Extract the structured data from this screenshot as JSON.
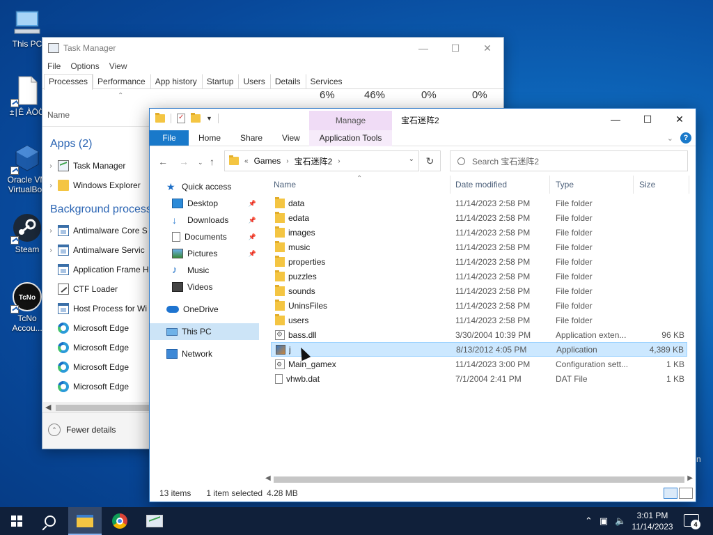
{
  "desktop": {
    "icons": [
      {
        "label": "This PC"
      },
      {
        "label": "±∣Ê ÀÖÖ"
      },
      {
        "label": "Oracle VM VirtualBox"
      },
      {
        "label": "Steam"
      },
      {
        "label": "TcNo Accou..."
      }
    ],
    "tcno_badge": "TcNo",
    "edge_fragment": "n"
  },
  "task_manager": {
    "title": "Task Manager",
    "menu": [
      "File",
      "Options",
      "View"
    ],
    "tabs": [
      "Processes",
      "Performance",
      "App history",
      "Startup",
      "Users",
      "Details",
      "Services"
    ],
    "active_tab": "Processes",
    "columns": {
      "name": "Name",
      "cpu_pct": "6%",
      "mem_pct": "46%",
      "disk_pct": "0%",
      "net_pct": "0%"
    },
    "apps_header": "Apps (2)",
    "apps": [
      {
        "name": "Task Manager",
        "icon": "task-manager-icon"
      },
      {
        "name": "Windows Explorer",
        "icon": "folder-icon"
      }
    ],
    "background_header": "Background processes",
    "background": [
      {
        "name": "Antimalware Core S",
        "icon": "process-icon",
        "expandable": true
      },
      {
        "name": "Antimalware Servic",
        "icon": "process-icon",
        "expandable": true
      },
      {
        "name": "Application Frame H",
        "icon": "process-icon",
        "expandable": false
      },
      {
        "name": "CTF Loader",
        "icon": "ctf-icon",
        "expandable": false
      },
      {
        "name": "Host Process for Wi",
        "icon": "process-icon",
        "expandable": false
      },
      {
        "name": "Microsoft Edge",
        "icon": "edge-icon",
        "expandable": false
      },
      {
        "name": "Microsoft Edge",
        "icon": "edge-icon",
        "expandable": false
      },
      {
        "name": "Microsoft Edge",
        "icon": "edge-icon",
        "expandable": false
      },
      {
        "name": "Microsoft Edge",
        "icon": "edge-icon",
        "expandable": false
      }
    ],
    "fewer_details": "Fewer details"
  },
  "explorer": {
    "title": "宝石迷阵2",
    "contextual_group": "Manage",
    "ribbon_tabs": [
      "File",
      "Home",
      "Share",
      "View"
    ],
    "contextual_tab": "Application Tools",
    "address": {
      "overflow": "«",
      "segments": [
        "Games",
        "宝石迷阵2"
      ]
    },
    "search_placeholder": "Search 宝石迷阵2",
    "nav": [
      {
        "label": "Quick access",
        "icon": "star-icon",
        "pinned": false
      },
      {
        "label": "Desktop",
        "icon": "desktop-icon",
        "pinned": true
      },
      {
        "label": "Downloads",
        "icon": "download-icon",
        "pinned": true
      },
      {
        "label": "Documents",
        "icon": "document-icon",
        "pinned": true
      },
      {
        "label": "Pictures",
        "icon": "pictures-icon",
        "pinned": true
      },
      {
        "label": "Music",
        "icon": "music-icon",
        "pinned": false
      },
      {
        "label": "Videos",
        "icon": "videos-icon",
        "pinned": false
      },
      {
        "label": "OneDrive",
        "icon": "cloud-icon",
        "pinned": false
      },
      {
        "label": "This PC",
        "icon": "computer-icon",
        "pinned": false
      },
      {
        "label": "Network",
        "icon": "network-icon",
        "pinned": false
      }
    ],
    "selected_nav": "This PC",
    "columns": {
      "name": "Name",
      "date": "Date modified",
      "type": "Type",
      "size": "Size"
    },
    "files": [
      {
        "name": "data",
        "date": "11/14/2023 2:58 PM",
        "type": "File folder",
        "size": "",
        "kind": "folder"
      },
      {
        "name": "edata",
        "date": "11/14/2023 2:58 PM",
        "type": "File folder",
        "size": "",
        "kind": "folder"
      },
      {
        "name": "images",
        "date": "11/14/2023 2:58 PM",
        "type": "File folder",
        "size": "",
        "kind": "folder"
      },
      {
        "name": "music",
        "date": "11/14/2023 2:58 PM",
        "type": "File folder",
        "size": "",
        "kind": "folder"
      },
      {
        "name": "properties",
        "date": "11/14/2023 2:58 PM",
        "type": "File folder",
        "size": "",
        "kind": "folder"
      },
      {
        "name": "puzzles",
        "date": "11/14/2023 2:58 PM",
        "type": "File folder",
        "size": "",
        "kind": "folder"
      },
      {
        "name": "sounds",
        "date": "11/14/2023 2:58 PM",
        "type": "File folder",
        "size": "",
        "kind": "folder"
      },
      {
        "name": "UninsFiles",
        "date": "11/14/2023 2:58 PM",
        "type": "File folder",
        "size": "",
        "kind": "folder"
      },
      {
        "name": "users",
        "date": "11/14/2023 2:58 PM",
        "type": "File folder",
        "size": "",
        "kind": "folder"
      },
      {
        "name": "bass.dll",
        "date": "3/30/2004 10:39 PM",
        "type": "Application exten...",
        "size": "96 KB",
        "kind": "dll"
      },
      {
        "name": "j",
        "date": "8/13/2012 4:05 PM",
        "type": "Application",
        "size": "4,389 KB",
        "kind": "app"
      },
      {
        "name": "Main_gamex",
        "date": "11/14/2023 3:00 PM",
        "type": "Configuration sett...",
        "size": "1 KB",
        "kind": "cfg"
      },
      {
        "name": "vhwb.dat",
        "date": "7/1/2004 2:41 PM",
        "type": "DAT File",
        "size": "1 KB",
        "kind": "dat"
      }
    ],
    "selected_file": "j",
    "status": {
      "count": "13 items",
      "selection": "1 item selected",
      "size": "4.28 MB"
    }
  },
  "taskbar": {
    "time": "3:01 PM",
    "date": "11/14/2023",
    "notification_count": "4"
  }
}
